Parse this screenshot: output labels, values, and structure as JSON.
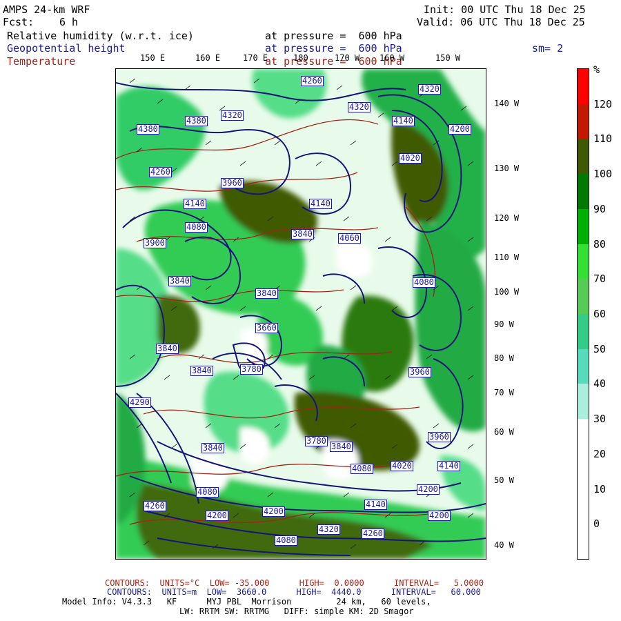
{
  "header": {
    "model": "AMPS 24-km WRF",
    "fcst_label": "Fcst:",
    "fcst_value": "6 h",
    "init": "Init: 00 UTC Thu 18 Dec 25",
    "valid": "Valid: 06 UTC Thu 18 Dec 25",
    "fields": [
      {
        "name": "Relative humidity (w.r.t. ice)",
        "level": "at pressure =  600 hPa",
        "color": "#000000"
      },
      {
        "name": "Geopotential height",
        "level": "at pressure =  600 hPa",
        "color": "#1a1a9c"
      },
      {
        "name": "Temperature",
        "level": "at pressure =  600 hPa",
        "color": "#a3241a"
      }
    ],
    "smoothing": "sm= 2"
  },
  "lon_labels": [
    "150 E",
    "160 E",
    "170 E",
    "180",
    "170 W",
    "160 W",
    "150 W"
  ],
  "lat_labels": [
    "140 W",
    "130 W",
    "120 W",
    "110 W",
    "100 W",
    "90 W",
    "80 W",
    "70 W",
    "60 W",
    "50 W",
    "40 W"
  ],
  "colorbar": {
    "unit": "%",
    "ticks": [
      "120",
      "110",
      "100",
      "90",
      "80",
      "70",
      "60",
      "50",
      "40",
      "30",
      "20",
      "10",
      "0"
    ],
    "colors": [
      "#ff0000",
      "#c21a00",
      "#3f5a00",
      "#007a00",
      "#00b000",
      "#33e033",
      "#55cc55",
      "#33cc88",
      "#55ddbb",
      "#aaeedd",
      "#ffffff",
      "#ffffff",
      "#ffffff",
      "#ffffff"
    ]
  },
  "contour_labels": [
    "4260",
    "4320",
    "4320",
    "4380",
    "4320",
    "4140",
    "4200",
    "4380",
    "4260",
    "3960",
    "4020",
    "4140",
    "4140",
    "4080",
    "3840",
    "4060",
    "3900",
    "4080",
    "3840",
    "3840",
    "3660",
    "3840",
    "3780",
    "4290",
    "3960",
    "3840",
    "3780",
    "3840",
    "3960",
    "3840",
    "4080",
    "4020",
    "4140",
    "4260",
    "4080",
    "4200",
    "4140",
    "4200",
    "4200",
    "4320",
    "4260",
    "4080",
    "4200"
  ],
  "footer": {
    "contours_temp": "CONTOURS:  UNITS=°C  LOW= -35.000      HIGH=  0.0000      INTERVAL=   5.0000",
    "contours_height": "CONTOURS:  UNITS=m  LOW=  3660.0      HIGH=  4440.0      INTERVAL=   60.000",
    "model_info": "Model Info: V4.3.3   KF      MYJ PBL  Morrison         24 km,   60 levels,",
    "physics": "LW: RRTM SW: RRTMG   DIFF: simple KM: 2D Smagor"
  }
}
